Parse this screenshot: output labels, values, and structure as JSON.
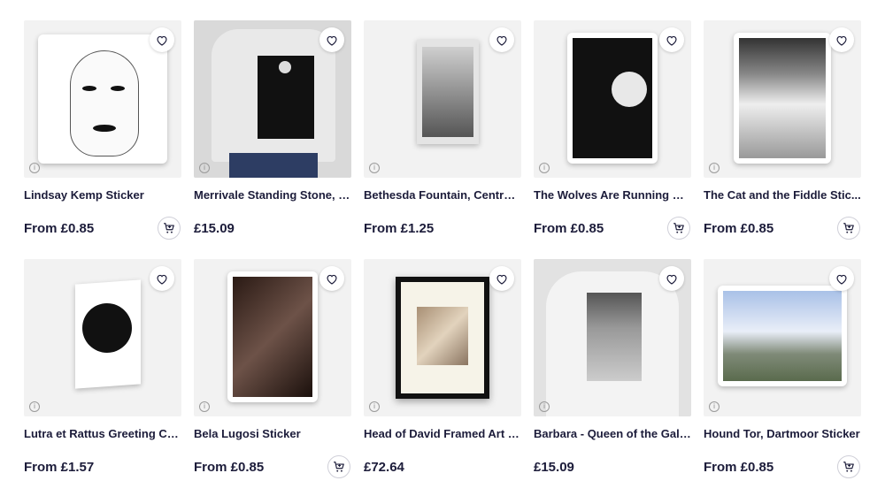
{
  "products": [
    {
      "title": "Lindsay Kemp Sticker",
      "price": "From £0.85",
      "art": "sticker-portrait",
      "cart": true
    },
    {
      "title": "Merrivale Standing Stone, D...",
      "price": "£15.09",
      "art": "tshirt-moon",
      "cart": false
    },
    {
      "title": "Bethesda Fountain, Central ...",
      "price": "From £1.25",
      "art": "greeting-card-fountain",
      "cart": false
    },
    {
      "title": "The Wolves Are Running Sti...",
      "price": "From £0.85",
      "art": "sticker-wolves",
      "cart": true
    },
    {
      "title": "The Cat and the Fiddle Stic...",
      "price": "From £0.85",
      "art": "sticker-cat-fiddle",
      "cart": true
    },
    {
      "title": "Lutra et Rattus Greeting Card",
      "price": "From £1.57",
      "art": "greeting-card-otter",
      "cart": false
    },
    {
      "title": "Bela Lugosi Sticker",
      "price": "From £0.85",
      "art": "sticker-lugosi",
      "cart": true
    },
    {
      "title": "Head of David Framed Art P...",
      "price": "£72.64",
      "art": "framed-print-david",
      "cart": false
    },
    {
      "title": "Barbara - Queen of the Gala...",
      "price": "£15.09",
      "art": "tshirt-barbara",
      "cart": false
    },
    {
      "title": "Hound Tor, Dartmoor Sticker",
      "price": "From £0.85",
      "art": "sticker-hound-tor",
      "cart": true
    }
  ],
  "icons": {
    "favorite": "heart-icon",
    "add_to_cart": "cart-icon",
    "info": "info-icon"
  },
  "colors": {
    "text": "#1c1c3a",
    "thumb_bg": "#f2f2f2"
  }
}
